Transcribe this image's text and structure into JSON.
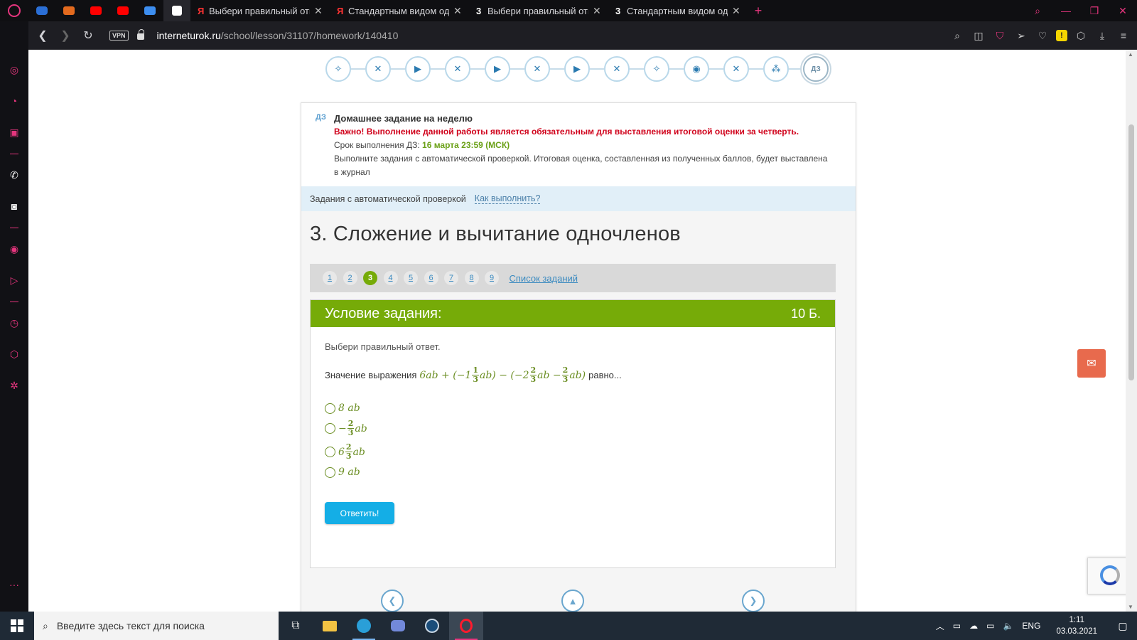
{
  "browser": {
    "tabs": [
      {
        "favicon": "Я",
        "title": "Выбери правильный отве",
        "close": "✕"
      },
      {
        "favicon": "Я",
        "title": "Стандартным видом одно",
        "close": "✕"
      },
      {
        "favicon": "3",
        "title": "Выбери правильный отве",
        "close": "✕"
      },
      {
        "favicon": "3",
        "title": "Стандартным видом одно",
        "close": "✕"
      }
    ],
    "url_host": "interneturok.ru",
    "url_path": "/school/lesson/31107/homework/140410",
    "vpn_label": "VPN",
    "accent_color": "#e5357d"
  },
  "lesson_steps": {
    "last_label": "ДЗ",
    "icons": [
      "lightbulb-icon",
      "dumbbell-icon",
      "play-icon",
      "dumbbell-icon",
      "play-icon",
      "dumbbell-icon",
      "play-icon",
      "dumbbell-icon",
      "lightbulb-icon",
      "target-icon",
      "dumbbell-icon",
      "stats-icon"
    ]
  },
  "homework": {
    "tag": "ДЗ",
    "title": "Домашнее задание на неделю",
    "important": "Важно! Выполнение данной работы является обязательным для выставления итоговой оценки за четверть.",
    "deadline_label": "Срок выполнения ДЗ:",
    "deadline_value": "16 марта 23:59 (МСК)",
    "description": "Выполните задания с автоматической проверкой. Итоговая оценка, составленная из полученных баллов, будет выставлена в журнал"
  },
  "auto_check": {
    "label": "Задания с автоматической проверкой",
    "how_link": "Как выполнить?"
  },
  "lesson": {
    "title": "3. Сложение и вычитание одночленов"
  },
  "pager": {
    "pages": [
      "1",
      "2",
      "3",
      "4",
      "5",
      "6",
      "7",
      "8",
      "9"
    ],
    "current": "3",
    "list_link": "Список заданий"
  },
  "task": {
    "header": "Условие задания:",
    "points": "10 Б.",
    "prompt": "Выбери правильный ответ.",
    "expr_prefix": "Значение выражения",
    "expr_suffix": "равно...",
    "expression": {
      "t1": "6ab + (−1",
      "f1_num": "1",
      "f1_den": "3",
      "t2": "ab) − (−2",
      "f2_num": "2",
      "f2_den": "3",
      "t3": "ab −",
      "f3_num": "2",
      "f3_den": "3",
      "t4": "ab)"
    },
    "options": [
      {
        "pre": "8",
        "var": "ab"
      },
      {
        "pre": "−",
        "num": "2",
        "den": "3",
        "var": "ab"
      },
      {
        "pre": "6",
        "num": "2",
        "den": "3",
        "var": "ab"
      },
      {
        "pre": "9",
        "var": "ab"
      }
    ],
    "answer_button": "Ответить!"
  },
  "taskbar": {
    "search_placeholder": "Введите здесь текст для поиска",
    "language": "ENG",
    "time": "1:11",
    "date": "03.03.2021"
  }
}
